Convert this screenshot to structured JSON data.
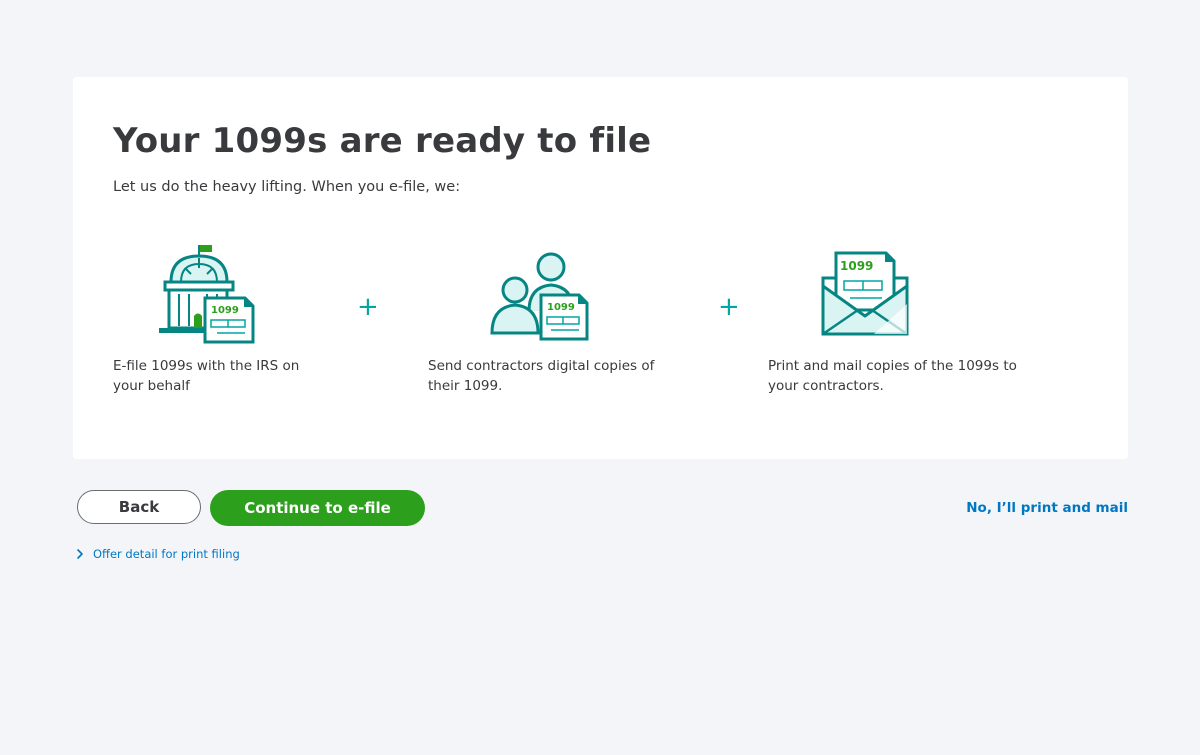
{
  "card": {
    "title": "Your 1099s are ready to file",
    "subtitle": "Let us do the heavy lifting. When you e-file, we:",
    "plus_sign": "+",
    "benefits": [
      {
        "icon": "irs-building-icon",
        "doc_label": "1099",
        "text": "E-file 1099s with the IRS on your behalf"
      },
      {
        "icon": "contractors-icon",
        "doc_label": "1099",
        "text": "Send contractors digital copies of their 1099."
      },
      {
        "icon": "envelope-icon",
        "doc_label": "1099",
        "text": "Print and mail copies of the 1099s to your contractors."
      }
    ]
  },
  "actions": {
    "back_label": "Back",
    "continue_label": "Continue to e-file",
    "print_mail_label": "No, I’ll print and mail",
    "offer_detail_label": "Offer detail for print filing"
  },
  "colors": {
    "background": "#f3f5f8",
    "card": "#ffffff",
    "teal": "#00a6a4",
    "dark_teal": "#068683",
    "green": "#2ca01c",
    "link_blue": "#0077c5",
    "text": "#393a3d"
  }
}
